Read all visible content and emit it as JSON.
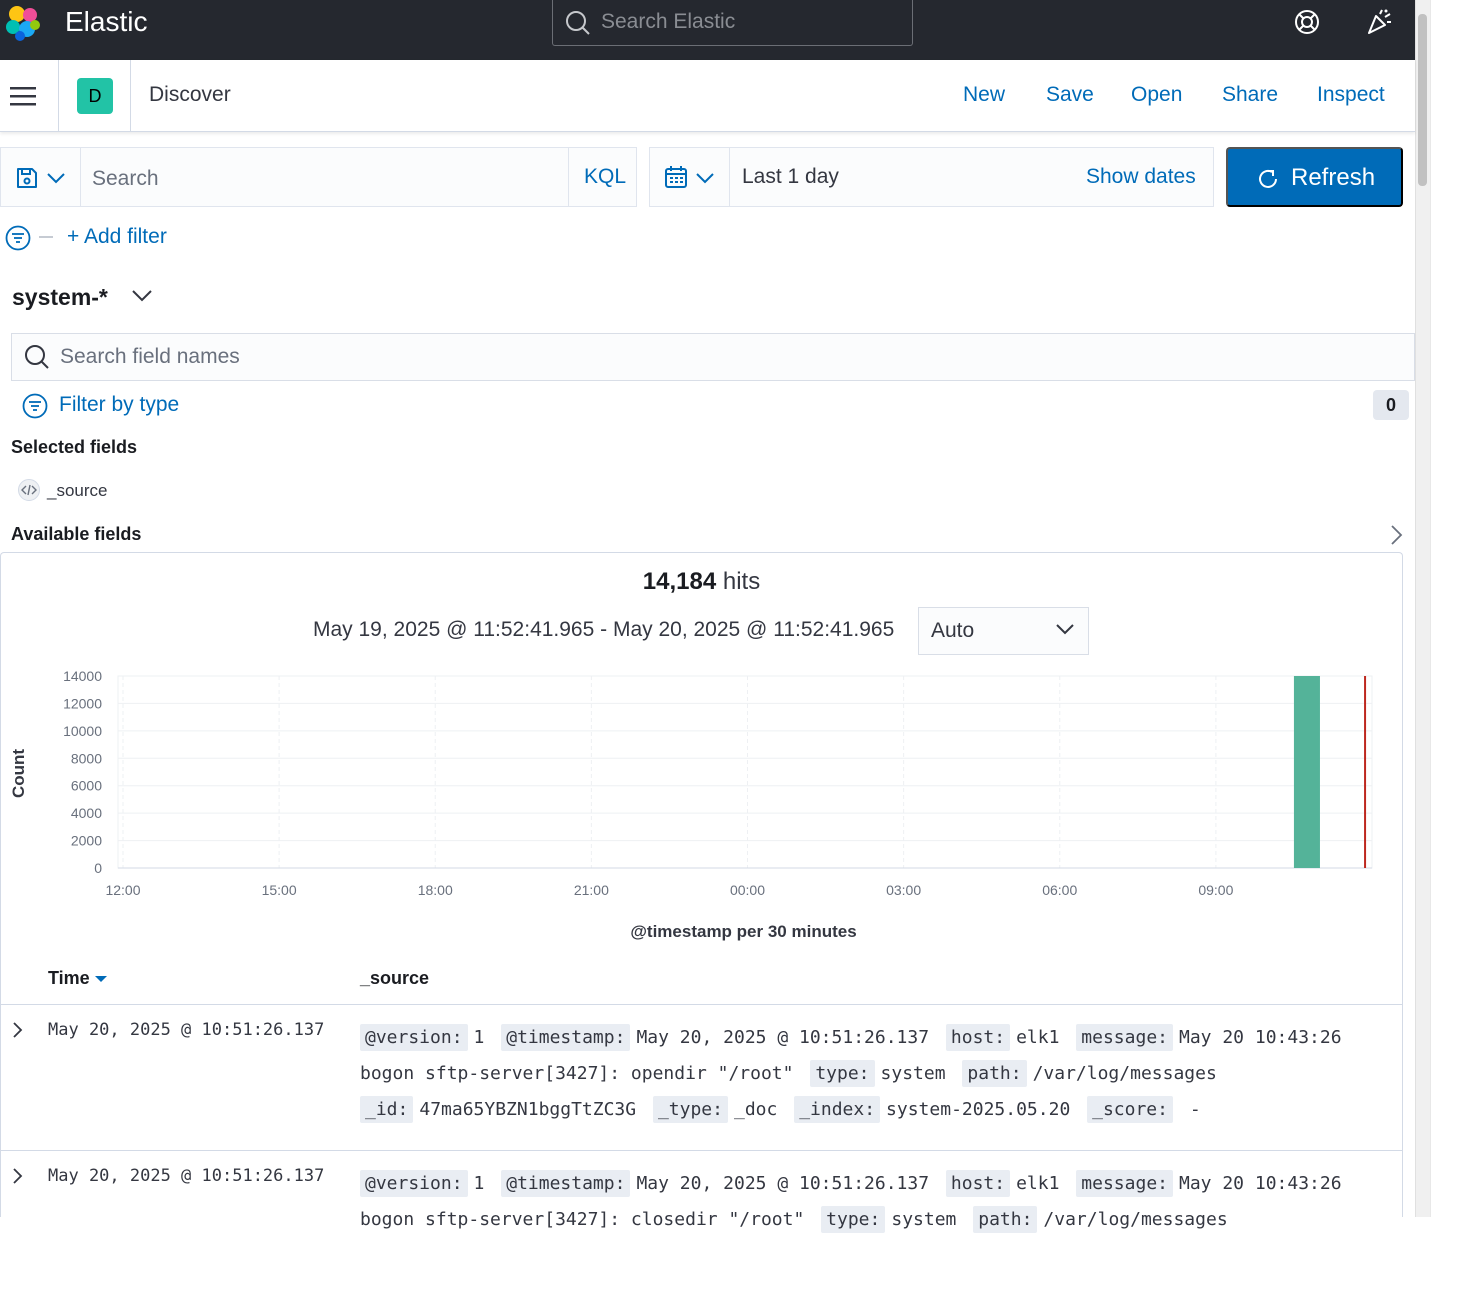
{
  "header": {
    "brand": "Elastic",
    "search_placeholder": "Search Elastic"
  },
  "appnav": {
    "space_initial": "D",
    "breadcrumb": "Discover",
    "links": [
      "New",
      "Save",
      "Open",
      "Share",
      "Inspect"
    ]
  },
  "query": {
    "placeholder": "Search",
    "language": "KQL"
  },
  "time": {
    "range": "Last 1 day",
    "show_dates": "Show dates",
    "refresh_label": "Refresh"
  },
  "filters": {
    "add_label": "+ Add filter"
  },
  "sidebar": {
    "index_pattern": "system-*",
    "field_search_placeholder": "Search field names",
    "filter_by_type": "Filter by type",
    "filter_count": "0",
    "selected_title": "Selected fields",
    "selected_fields": [
      "_source"
    ],
    "available_title": "Available fields"
  },
  "summary": {
    "hits_count": "14,184",
    "hits_word": "hits",
    "time_range": "May 19, 2025 @ 11:52:41.965 - May 20, 2025 @ 11:52:41.965",
    "interval": "Auto"
  },
  "chart_data": {
    "type": "bar",
    "ylabel": "Count",
    "xlabel": "@timestamp per 30 minutes",
    "y_ticks": [
      "0",
      "2000",
      "4000",
      "6000",
      "8000",
      "10000",
      "12000",
      "14000"
    ],
    "ylim": [
      0,
      14000
    ],
    "x_ticks": [
      "12:00",
      "15:00",
      "18:00",
      "21:00",
      "00:00",
      "03:00",
      "06:00",
      "09:00"
    ],
    "bars": [
      {
        "x": "10:30",
        "value": 14184
      }
    ],
    "now_marker": "11:52",
    "bar_color": "#54b399",
    "marker_color": "#bd271e",
    "grid": true
  },
  "table": {
    "col_time": "Time",
    "col_source": "_source",
    "rows": [
      {
        "time": "May 20, 2025 @ 10:51:26.137",
        "fields": [
          {
            "k": "@version:",
            "v": "1"
          },
          {
            "k": "@timestamp:",
            "v": "May 20, 2025 @ 10:51:26.137"
          },
          {
            "k": "host:",
            "v": "elk1"
          },
          {
            "k": "message:",
            "v": "May 20 10:43:26 bogon sftp-server[3427]: opendir \"/root\""
          },
          {
            "k": "type:",
            "v": "system"
          },
          {
            "k": "path:",
            "v": "/var/log/messages"
          },
          {
            "k": "_id:",
            "v": "47ma65YBZN1bggTtZC3G"
          },
          {
            "k": "_type:",
            "v": "_doc"
          },
          {
            "k": "_index:",
            "v": "system-2025.05.20"
          },
          {
            "k": "_score:",
            "v": " -"
          }
        ]
      },
      {
        "time": "May 20, 2025 @ 10:51:26.137",
        "fields": [
          {
            "k": "@version:",
            "v": "1"
          },
          {
            "k": "@timestamp:",
            "v": "May 20, 2025 @ 10:51:26.137"
          },
          {
            "k": "host:",
            "v": "elk1"
          },
          {
            "k": "message:",
            "v": "May 20 10:43:26 bogon sftp-server[3427]: closedir \"/root\""
          },
          {
            "k": "type:",
            "v": "system"
          },
          {
            "k": "path:",
            "v": "/var/log/messages"
          }
        ]
      }
    ]
  }
}
